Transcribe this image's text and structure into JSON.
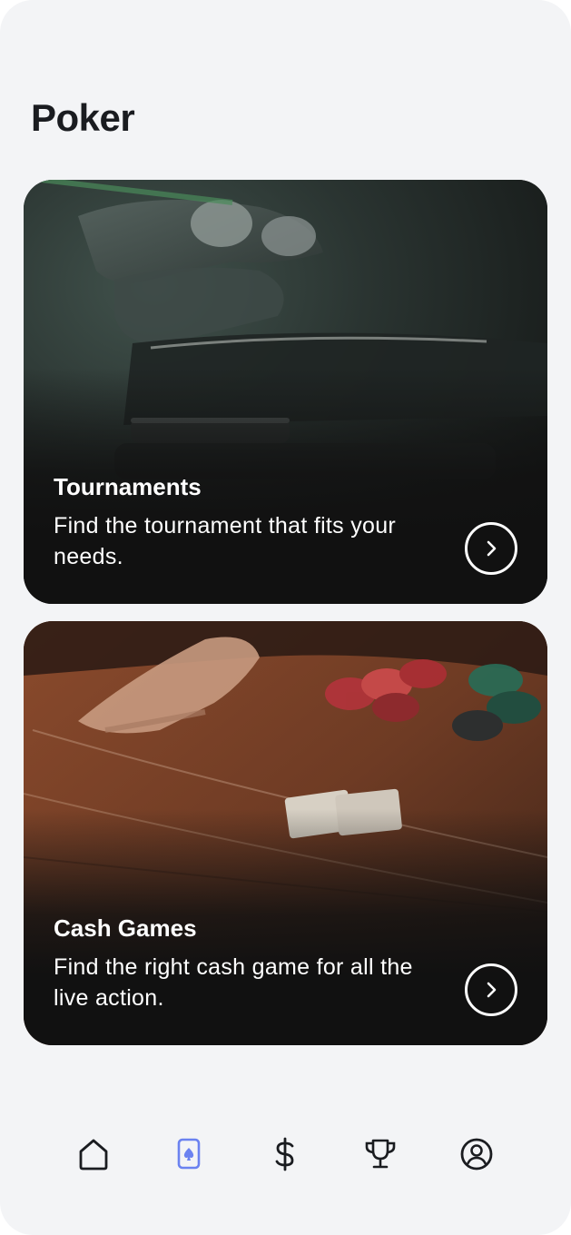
{
  "page": {
    "title": "Poker"
  },
  "cards": [
    {
      "title": "Tournaments",
      "description": "Find the tournament that fits your needs.",
      "action_icon": "chevron-right-circle-icon"
    },
    {
      "title": "Cash Games",
      "description": "Find the right cash game for all the live action.",
      "action_icon": "chevron-right-circle-icon"
    }
  ],
  "tabbar": {
    "items": [
      {
        "id": "home",
        "icon": "home-icon",
        "active": false
      },
      {
        "id": "poker",
        "icon": "spade-card-icon",
        "active": true
      },
      {
        "id": "cash",
        "icon": "dollar-icon",
        "active": false
      },
      {
        "id": "trophy",
        "icon": "trophy-icon",
        "active": false
      },
      {
        "id": "profile",
        "icon": "user-circle-icon",
        "active": false
      }
    ]
  },
  "colors": {
    "background": "#f3f4f6",
    "card_bg": "#111111",
    "accent": "#6b82f0",
    "icon": "#1a1c20"
  }
}
